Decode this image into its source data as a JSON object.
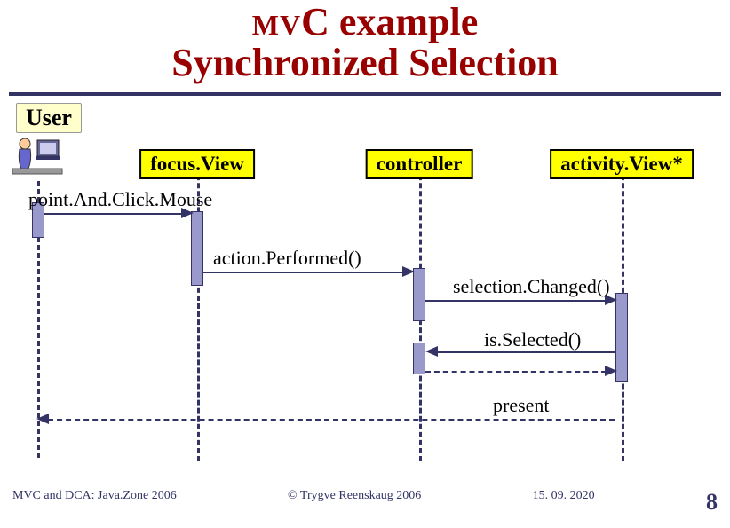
{
  "title": {
    "line1_prefix": "MV",
    "line1_rest": "C example",
    "line2": "Synchronized Selection"
  },
  "actor_label": "User",
  "lifelines": {
    "focusView": "focus.View",
    "controller": "controller",
    "activityView": "activity.View*"
  },
  "messages": {
    "pointAndClick": "point.And.Click.Mouse",
    "actionPerformed": "action.Performed()",
    "selectionChanged": "selection.Changed()",
    "isSelected": "is.Selected()",
    "present": "present"
  },
  "footer": {
    "left": "MVC and DCA:  Java.Zone 2006",
    "center": "© Trygve Reenskaug 2006",
    "date": "15. 09. 2020",
    "page": "8"
  },
  "colors": {
    "accent": "#333366",
    "title": "#990000",
    "box": "#ffff00"
  }
}
